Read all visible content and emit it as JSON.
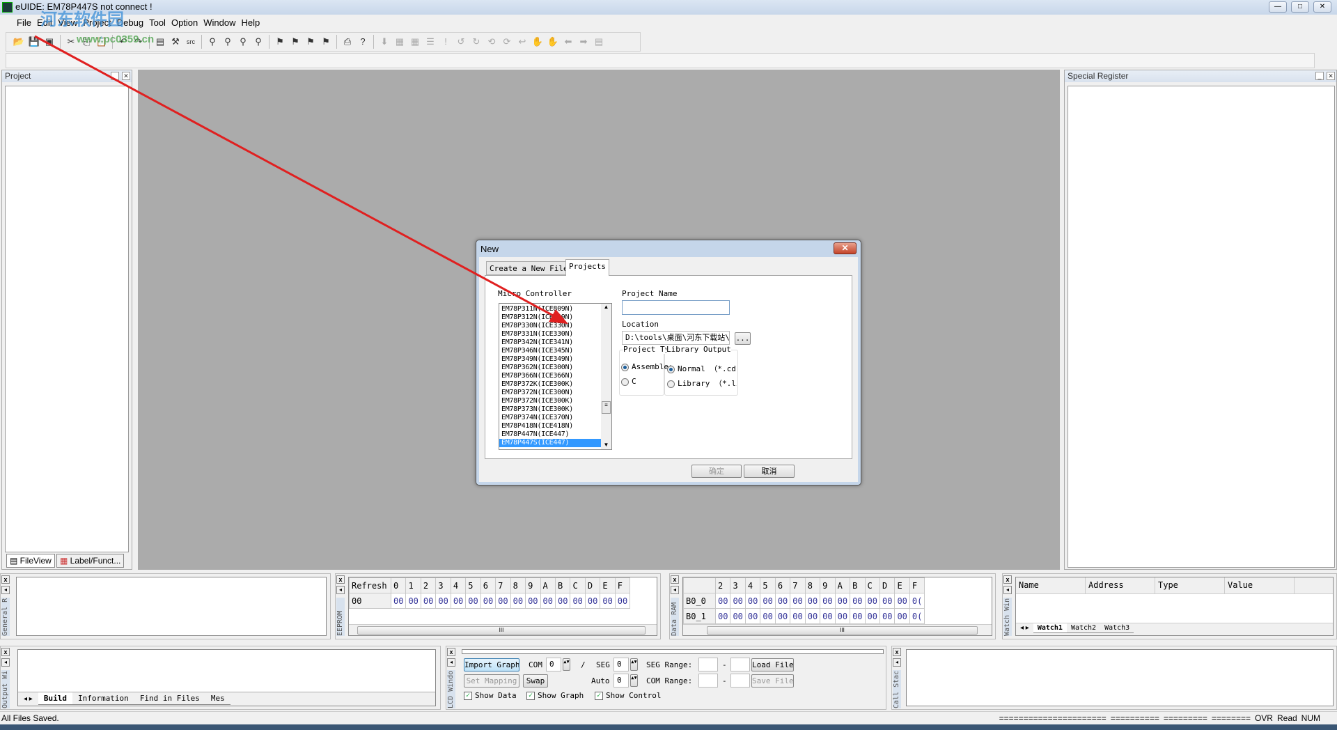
{
  "window": {
    "title": "eUIDE: EM78P447S not connect !",
    "minimize": "—",
    "maximize": "□",
    "close": "✕"
  },
  "watermark": {
    "site_name": "河东软件园",
    "url": "www.pc0359.cn"
  },
  "menu": [
    "File",
    "Edit",
    "View",
    "Project",
    "Debug",
    "Tool",
    "Option",
    "Window",
    "Help"
  ],
  "toolbar": [
    {
      "icon": "open-icon",
      "glyph": "📂"
    },
    {
      "icon": "save-icon",
      "glyph": "💾"
    },
    {
      "icon": "save-all-icon",
      "glyph": "▣"
    },
    {
      "icon": "cut-icon",
      "glyph": "✂"
    },
    {
      "icon": "copy-icon",
      "glyph": "⎘"
    },
    {
      "icon": "paste-icon",
      "glyph": "📋"
    },
    {
      "icon": "undo-icon",
      "glyph": "↶"
    },
    {
      "icon": "redo-icon",
      "glyph": "↷"
    },
    {
      "icon": "window-icon",
      "glyph": "▤"
    },
    {
      "icon": "build-icon",
      "glyph": "⚒"
    },
    {
      "icon": "src-icon",
      "glyph": "src"
    },
    {
      "icon": "find-icon",
      "glyph": "⚲"
    },
    {
      "icon": "find-next-icon",
      "glyph": "⚲"
    },
    {
      "icon": "replace-icon",
      "glyph": "⚲"
    },
    {
      "icon": "find-in-files-icon",
      "glyph": "⚲"
    },
    {
      "icon": "bookmark-icon",
      "glyph": "⚑"
    },
    {
      "icon": "bookmark-next-icon",
      "glyph": "⚑"
    },
    {
      "icon": "bookmark-prev-icon",
      "glyph": "⚑"
    },
    {
      "icon": "bookmark-clear-icon",
      "glyph": "⚑"
    },
    {
      "icon": "print-icon",
      "glyph": "⎙"
    },
    {
      "icon": "help-icon",
      "glyph": "?"
    }
  ],
  "toolbar_debug": [
    {
      "icon": "download-icon",
      "glyph": "⬇"
    },
    {
      "icon": "run-icon",
      "glyph": "▦"
    },
    {
      "icon": "go-icon",
      "glyph": "▦"
    },
    {
      "icon": "list-icon",
      "glyph": "☰"
    },
    {
      "icon": "stop-icon",
      "glyph": "!"
    },
    {
      "icon": "step-into-icon",
      "glyph": "↺"
    },
    {
      "icon": "step-over-icon",
      "glyph": "↻"
    },
    {
      "icon": "step-out-icon",
      "glyph": "⟲"
    },
    {
      "icon": "step-back-icon",
      "glyph": "⟳"
    },
    {
      "icon": "reset-icon",
      "glyph": "↩"
    },
    {
      "icon": "hand-icon",
      "glyph": "✋"
    },
    {
      "icon": "breakpoint-icon",
      "glyph": "✋"
    },
    {
      "icon": "back-icon",
      "glyph": "⬅"
    },
    {
      "icon": "forward-icon",
      "glyph": "➡"
    },
    {
      "icon": "page-icon",
      "glyph": "▤"
    }
  ],
  "project_panel": {
    "title": "Project",
    "tabs": [
      "FileView",
      "Label/Funct..."
    ]
  },
  "special_register": {
    "title": "Special Register"
  },
  "dialog": {
    "title": "New",
    "tabs": [
      "Create a New File",
      "Projects"
    ],
    "active_tab": "Projects",
    "mc_label": "Micro Controller",
    "mc_list": [
      "EM78P311N(ICE809N)",
      "EM78P312N(ICE809N)",
      "EM78P330N(ICE330N)",
      "EM78P331N(ICE330N)",
      "EM78P342N(ICE341N)",
      "EM78P346N(ICE345N)",
      "EM78P349N(ICE349N)",
      "EM78P362N(ICE300N)",
      "EM78P366N(ICE366N)",
      "EM78P372K(ICE300K)",
      "EM78P372N(ICE300N)",
      "EM78P372N(ICE300K)",
      "EM78P373N(ICE300K)",
      "EM78P374N(ICE370N)",
      "EM78P418N(ICE418N)",
      "EM78P447N(ICE447)",
      "EM78P447S(ICE447)"
    ],
    "mc_selected": "EM78P447S(ICE447)",
    "project_name_label": "Project Name",
    "project_name_value": "",
    "location_label": "Location",
    "location_value": "D:\\tools\\桌面\\河东下载站\\",
    "browse_label": "...",
    "project_type_label": "Project Typ:",
    "project_types": [
      "Assemble:",
      "C"
    ],
    "project_type_selected": "Assemble:",
    "library_output_label": "Library Output",
    "library_outputs": [
      "Normal （*.cds",
      "Library （*.li"
    ],
    "library_output_selected": "Normal （*.cds",
    "ok_label": "确定",
    "cancel_label": "取消"
  },
  "general_panel": {
    "label": "General R"
  },
  "eeprom": {
    "label": "EEPROM",
    "refresh_label": "Refresh",
    "columns": [
      "0",
      "1",
      "2",
      "3",
      "4",
      "5",
      "6",
      "7",
      "8",
      "9",
      "A",
      "B",
      "C",
      "D",
      "E",
      "F"
    ],
    "rows": [
      {
        "addr": "00",
        "values": [
          "00",
          "00",
          "00",
          "00",
          "00",
          "00",
          "00",
          "00",
          "00",
          "00",
          "00",
          "00",
          "00",
          "00",
          "00",
          "00"
        ]
      }
    ]
  },
  "data_ram": {
    "label": "Data RAM",
    "columns": [
      "2",
      "3",
      "4",
      "5",
      "6",
      "7",
      "8",
      "9",
      "A",
      "B",
      "C",
      "D",
      "E",
      "F"
    ],
    "rows": [
      {
        "addr": "B0_0",
        "values": [
          "00",
          "00",
          "00",
          "00",
          "00",
          "00",
          "00",
          "00",
          "00",
          "00",
          "00",
          "00",
          "00",
          "0("
        ]
      },
      {
        "addr": "B0_1",
        "values": [
          "00",
          "00",
          "00",
          "00",
          "00",
          "00",
          "00",
          "00",
          "00",
          "00",
          "00",
          "00",
          "00",
          "0("
        ]
      }
    ]
  },
  "watch": {
    "label": "Watch Win",
    "columns": [
      "Name",
      "Address",
      "Type",
      "Value"
    ],
    "tabs": [
      "Watch1",
      "Watch2",
      "Watch3"
    ],
    "active_tab": "Watch1"
  },
  "output": {
    "label": "Output Wi",
    "tabs": [
      "Build",
      "Information",
      "Find in Files",
      "Mes"
    ],
    "active_tab": "Build"
  },
  "lcd": {
    "label": "LCD Windo",
    "import_graph": "Import Graph",
    "set_mapping": "Set Mapping",
    "swap": "Swap",
    "com_label": "COM",
    "com_value": "0",
    "slash": "/",
    "seg_label": "SEG",
    "seg_value": "0",
    "auto_label": "Auto",
    "auto_value": "0",
    "seg_range_label": "SEG Range:",
    "com_range_label": "COM Range:",
    "dash": "-",
    "load_file": "Load File",
    "save_file": "Save File",
    "show_data": "Show Data",
    "show_graph": "Show Graph",
    "show_control": "Show Control",
    "show_data_checked": true,
    "show_graph_checked": true,
    "show_control_checked": true
  },
  "call_stack": {
    "label": "Call Stac"
  },
  "status": {
    "message": "All Files Saved.",
    "segments": [
      "======================",
      "==========",
      "=========",
      "========",
      "OVR",
      "Read",
      "NUM"
    ]
  },
  "colors": {
    "accent_arrow": "#e02020",
    "selection": "#3399ff",
    "workspace": "#ababab",
    "hex_value": "#333399"
  }
}
